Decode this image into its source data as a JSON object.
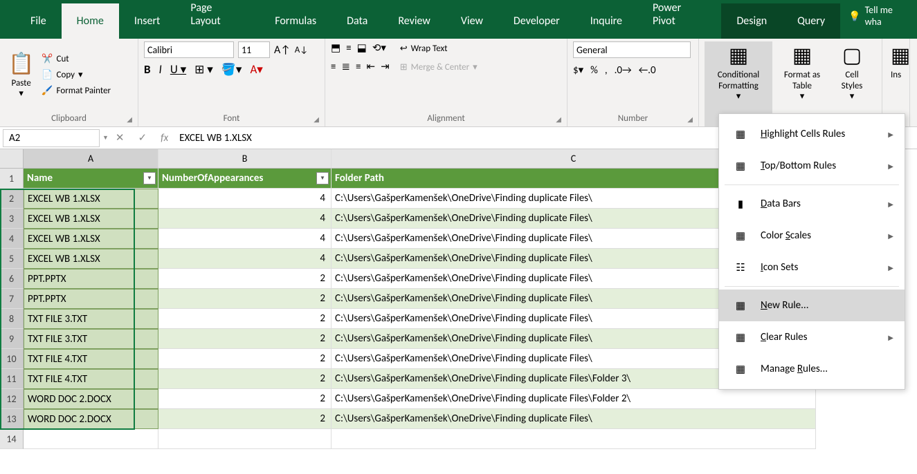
{
  "tabs": [
    "File",
    "Home",
    "Insert",
    "Page Layout",
    "Formulas",
    "Data",
    "Review",
    "View",
    "Developer",
    "Inquire",
    "Power Pivot",
    "Design",
    "Query"
  ],
  "activeTab": "Home",
  "tellMe": "Tell me wha",
  "clipboard": {
    "cut": "Cut",
    "copy": "Copy",
    "paste": "Paste",
    "formatPainter": "Format Painter",
    "label": "Clipboard"
  },
  "font": {
    "name": "Calibri",
    "size": "11",
    "label": "Font"
  },
  "alignment": {
    "wrap": "Wrap Text",
    "merge": "Merge & Center",
    "label": "Alignment"
  },
  "number": {
    "format": "General",
    "label": "Number"
  },
  "styles": {
    "cond": "Conditional Formatting",
    "formatAs": "Format as Table",
    "cell": "Cell Styles",
    "ins": "Ins"
  },
  "nameBox": "A2",
  "formula": "EXCEL WB 1.XLSX",
  "headers": {
    "a": "Name",
    "b": "NumberOfAppearances",
    "c": "Folder Path"
  },
  "rows": [
    {
      "name": "EXCEL WB 1.XLSX",
      "num": 4,
      "path": "C:\\Users\\GašperKamenšek\\OneDrive\\Finding duplicate Files\\"
    },
    {
      "name": "EXCEL WB 1.XLSX",
      "num": 4,
      "path": "C:\\Users\\GašperKamenšek\\OneDrive\\Finding duplicate Files\\"
    },
    {
      "name": "EXCEL WB 1.XLSX",
      "num": 4,
      "path": "C:\\Users\\GašperKamenšek\\OneDrive\\Finding duplicate Files\\"
    },
    {
      "name": "EXCEL WB 1.XLSX",
      "num": 4,
      "path": "C:\\Users\\GašperKamenšek\\OneDrive\\Finding duplicate Files\\"
    },
    {
      "name": "PPT.PPTX",
      "num": 2,
      "path": "C:\\Users\\GašperKamenšek\\OneDrive\\Finding duplicate Files\\"
    },
    {
      "name": "PPT.PPTX",
      "num": 2,
      "path": "C:\\Users\\GašperKamenšek\\OneDrive\\Finding duplicate Files\\"
    },
    {
      "name": "TXT FILE 3.TXT",
      "num": 2,
      "path": "C:\\Users\\GašperKamenšek\\OneDrive\\Finding duplicate Files\\"
    },
    {
      "name": "TXT FILE 3.TXT",
      "num": 2,
      "path": "C:\\Users\\GašperKamenšek\\OneDrive\\Finding duplicate Files\\"
    },
    {
      "name": "TXT FILE 4.TXT",
      "num": 2,
      "path": "C:\\Users\\GašperKamenšek\\OneDrive\\Finding duplicate Files\\"
    },
    {
      "name": "TXT FILE 4.TXT",
      "num": 2,
      "path": "C:\\Users\\GašperKamenšek\\OneDrive\\Finding duplicate Files\\Folder 3\\"
    },
    {
      "name": "WORD DOC 2.DOCX",
      "num": 2,
      "path": "C:\\Users\\GašperKamenšek\\OneDrive\\Finding duplicate Files\\Folder 2\\"
    },
    {
      "name": "WORD DOC 2.DOCX",
      "num": 2,
      "path": "C:\\Users\\GašperKamenšek\\OneDrive\\Finding duplicate Files\\"
    }
  ],
  "cfMenu": {
    "highlight": "Highlight Cells Rules",
    "topbottom": "Top/Bottom Rules",
    "databars": "Data Bars",
    "colorscales": "Color Scales",
    "iconsets": "Icon Sets",
    "newrule": "New Rule...",
    "clear": "Clear Rules",
    "manage": "Manage Rules..."
  }
}
